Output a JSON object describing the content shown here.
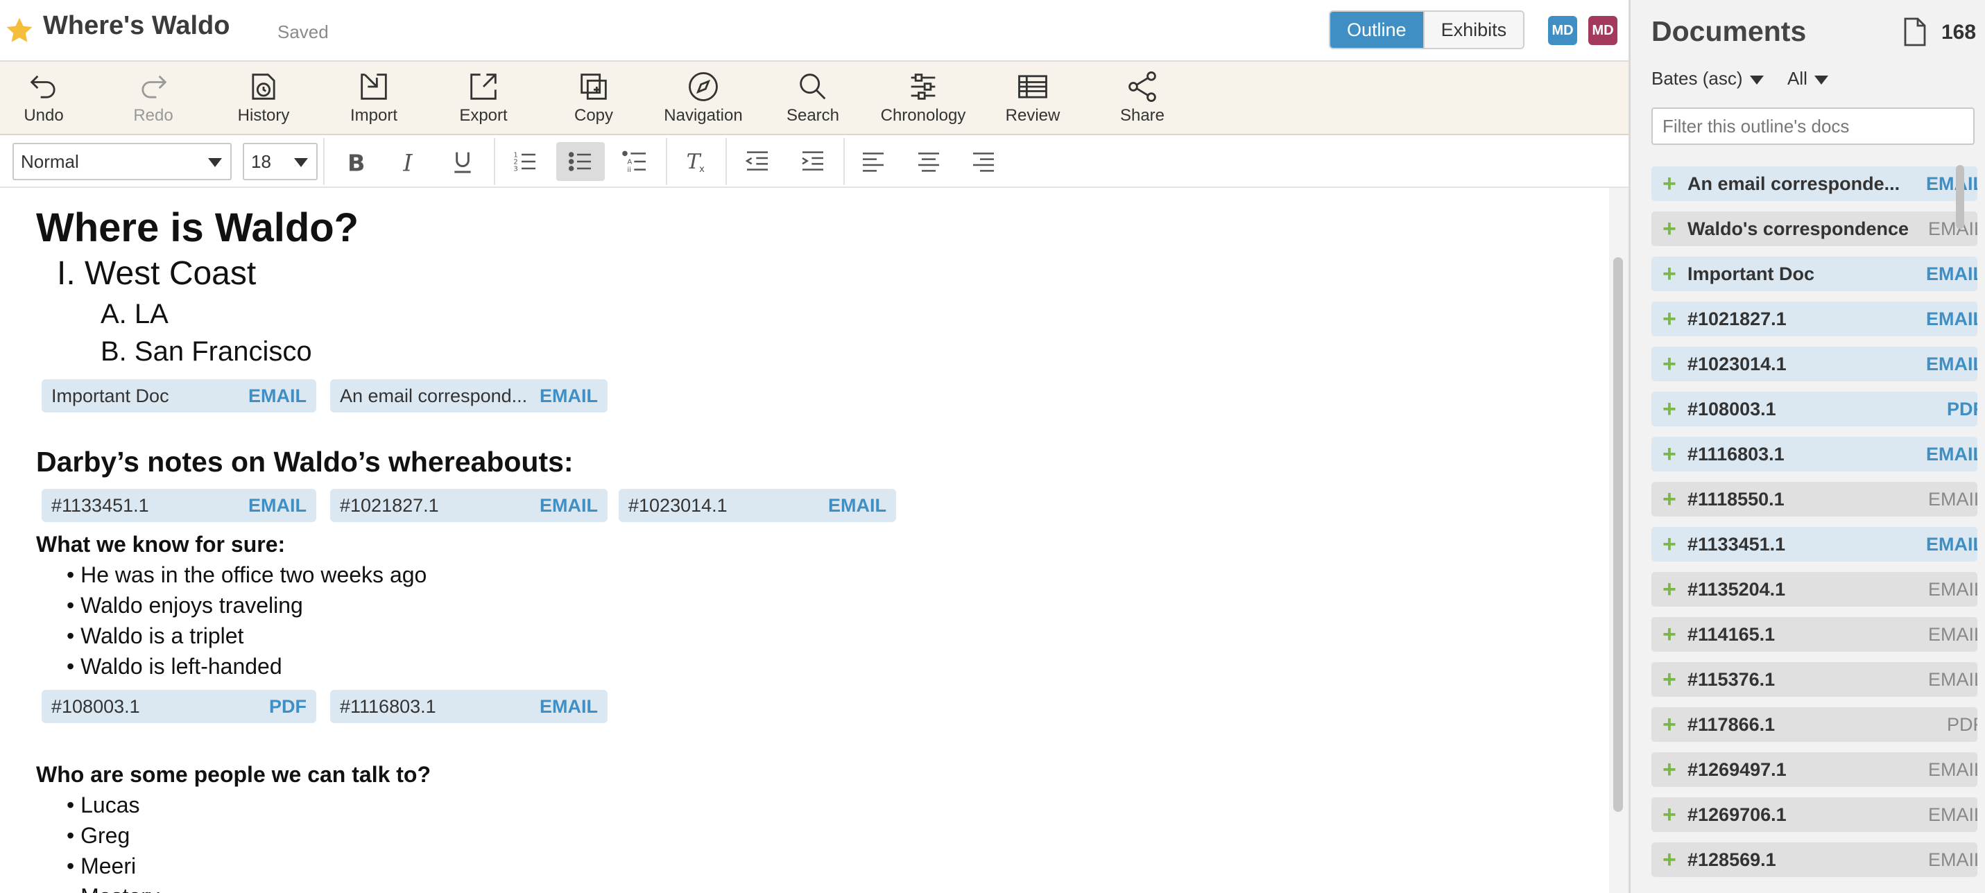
{
  "header": {
    "title": "Where's Waldo",
    "status": "Saved",
    "view_tabs": [
      "Outline",
      "Exhibits"
    ],
    "avatars": [
      {
        "initials": "MD",
        "color": "#3f8fc4"
      },
      {
        "initials": "MD",
        "color": "#a33a5e"
      }
    ]
  },
  "toolbar": {
    "tools": [
      {
        "label": "Undo",
        "icon": "undo-icon"
      },
      {
        "label": "Redo",
        "icon": "redo-icon"
      },
      {
        "label": "History",
        "icon": "history-icon"
      },
      {
        "label": "Import",
        "icon": "import-icon"
      },
      {
        "label": "Export",
        "icon": "export-icon"
      },
      {
        "label": "Copy",
        "icon": "copy-icon"
      },
      {
        "label": "Navigation",
        "icon": "compass-icon"
      },
      {
        "label": "Search",
        "icon": "search-icon"
      },
      {
        "label": "Chronology",
        "icon": "chronology-icon"
      },
      {
        "label": "Review",
        "icon": "review-icon"
      },
      {
        "label": "Share",
        "icon": "share-icon"
      }
    ]
  },
  "format": {
    "style": "Normal",
    "font_size": "18"
  },
  "editor": {
    "title": "Where is Waldo?",
    "outline_l1": "I. West Coast",
    "outline_l2": [
      "A. LA",
      "B. San Francisco"
    ],
    "chips_1": [
      {
        "name": "Important Doc",
        "type": "EMAIL"
      },
      {
        "name": "An email correspond...",
        "type": "EMAIL"
      }
    ],
    "section_heading": "Darby’s notes on Waldo’s whereabouts:",
    "chips_2": [
      {
        "name": "#1133451.1",
        "type": "EMAIL"
      },
      {
        "name": "#1021827.1",
        "type": "EMAIL"
      },
      {
        "name": "#1023014.1",
        "type": "EMAIL"
      }
    ],
    "subheading_1": "What we know for sure:",
    "bullets_1": [
      "He was in the office two weeks ago",
      "Waldo enjoys traveling",
      "Waldo is a triplet",
      "Waldo is left-handed"
    ],
    "chips_3": [
      {
        "name": "#108003.1",
        "type": "PDF"
      },
      {
        "name": "#1116803.1",
        "type": "EMAIL"
      }
    ],
    "subheading_2": "Who are some people we can talk to?",
    "bullets_2": [
      "Lucas",
      "Greg",
      "Meeri",
      "Mastery"
    ]
  },
  "sidebar": {
    "title": "Documents",
    "count": "168",
    "sort": "Bates (asc)",
    "filter_mode": "All",
    "filter_placeholder": "Filter this outline's docs",
    "docs": [
      {
        "name": "An email corresponde...",
        "type": "EMAIL",
        "style": "blue"
      },
      {
        "name": "Waldo's correspondence",
        "type": "EMAIL",
        "style": "gray"
      },
      {
        "name": "Important Doc",
        "type": "EMAIL",
        "style": "blue"
      },
      {
        "name": "#1021827.1",
        "type": "EMAIL",
        "style": "blue"
      },
      {
        "name": "#1023014.1",
        "type": "EMAIL",
        "style": "blue"
      },
      {
        "name": "#108003.1",
        "type": "PDF",
        "style": "blue"
      },
      {
        "name": "#1116803.1",
        "type": "EMAIL",
        "style": "blue"
      },
      {
        "name": "#1118550.1",
        "type": "EMAIL",
        "style": "gray"
      },
      {
        "name": "#1133451.1",
        "type": "EMAIL",
        "style": "blue"
      },
      {
        "name": "#1135204.1",
        "type": "EMAIL",
        "style": "gray"
      },
      {
        "name": "#114165.1",
        "type": "EMAIL",
        "style": "gray"
      },
      {
        "name": "#115376.1",
        "type": "EMAIL",
        "style": "gray"
      },
      {
        "name": "#117866.1",
        "type": "PDF",
        "style": "gray"
      },
      {
        "name": "#1269497.1",
        "type": "EMAIL",
        "style": "gray"
      },
      {
        "name": "#1269706.1",
        "type": "EMAIL",
        "style": "gray"
      },
      {
        "name": "#128569.1",
        "type": "EMAIL",
        "style": "gray"
      }
    ]
  },
  "colors": {
    "accent": "#3f8fc4",
    "toolbar_bg": "#f7f3ea",
    "chip_bg": "#dbe8f2",
    "plus_green": "#7ab648"
  }
}
